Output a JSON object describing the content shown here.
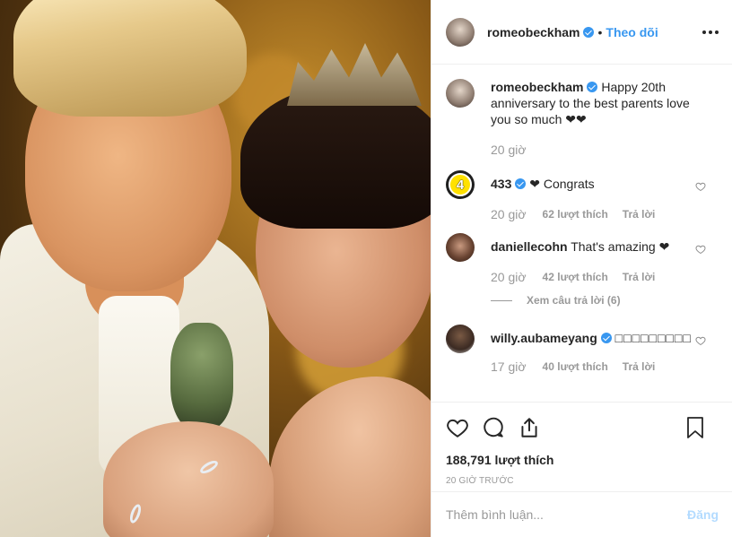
{
  "header": {
    "username": "romeobeckham",
    "follow_label": "Theo dõi",
    "separator": "•"
  },
  "caption": {
    "username": "romeobeckham",
    "text": "Happy 20th anniversary to the best parents love you so much ❤❤",
    "time": "20 giờ"
  },
  "comments": [
    {
      "username": "433",
      "text": "❤ Congrats",
      "time": "20 giờ",
      "likes": "62 lượt thích",
      "reply_label": "Trả lời"
    },
    {
      "username": "daniellecohn",
      "text": "That's amazing ❤",
      "time": "20 giờ",
      "likes": "42 lượt thích",
      "reply_label": "Trả lời",
      "view_replies": "Xem câu trả lời (6)"
    },
    {
      "username": "willy.aubameyang",
      "text": "□□□□□□□□□",
      "time": "17 giờ",
      "likes": "40 lượt thích",
      "reply_label": "Trả lời"
    }
  ],
  "stats": {
    "likes": "188,791 lượt thích",
    "posted": "20 GIỜ TRƯỚC"
  },
  "add_comment": {
    "placeholder": "Thêm bình luận...",
    "post_label": "Đăng"
  },
  "colors": {
    "accent": "#3897f0",
    "muted": "#999999",
    "border": "#efefef",
    "post_disabled": "#b3dbff"
  },
  "icons": {
    "verified": "verified-badge-icon",
    "like": "heart-icon",
    "comment": "comment-bubble-icon",
    "share": "share-icon",
    "save": "bookmark-icon",
    "more": "more-options-icon"
  }
}
